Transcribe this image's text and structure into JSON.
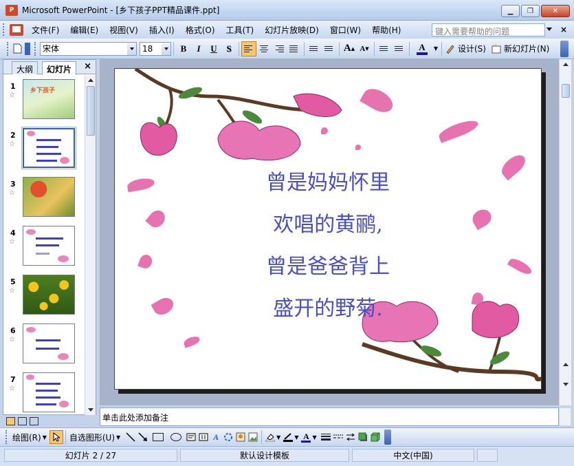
{
  "window": {
    "title": "Microsoft PowerPoint - [乡下孩子PPT精品课件.ppt]",
    "minimize": "0",
    "restore": "1",
    "close": "r"
  },
  "menu": {
    "items": [
      "文件(F)",
      "编辑(E)",
      "视图(V)",
      "插入(I)",
      "格式(O)",
      "工具(T)",
      "幻灯片放映(D)",
      "窗口(W)",
      "帮助(H)"
    ],
    "help_placeholder": "键入需要帮助的问题",
    "doc_close": "×"
  },
  "toolbar": {
    "font_name": "宋体",
    "font_size": "18",
    "bold": "B",
    "italic": "I",
    "underline": "U",
    "shadow": "S",
    "grow_font": "A",
    "shrink_font": "A",
    "font_color": "A",
    "design_label": "设计(S)",
    "new_slide_label": "新幻灯片(N)"
  },
  "left_pane": {
    "tab_outline": "大纲",
    "tab_slides": "幻灯片",
    "close": "×",
    "slides": [
      {
        "num": "1",
        "title": "乡下孩子"
      },
      {
        "num": "2"
      },
      {
        "num": "3"
      },
      {
        "num": "4"
      },
      {
        "num": "5"
      },
      {
        "num": "6"
      },
      {
        "num": "7"
      }
    ],
    "star": "☆"
  },
  "slide": {
    "lines": [
      "曾是妈妈怀里",
      "欢唱的黄鹂,",
      "曾是爸爸背上",
      "盛开的野菊."
    ],
    "text_color": "#4a4ec3",
    "blossom_color": "#e25aa2"
  },
  "notes": {
    "placeholder": "单击此处添加备注"
  },
  "drawbar": {
    "draw_label": "绘图(R)",
    "autoshapes_label": "自选图形(U)"
  },
  "status": {
    "slide_info": "幻灯片 2 / 27",
    "template": "默认设计模板",
    "language": "中文(中国)"
  }
}
